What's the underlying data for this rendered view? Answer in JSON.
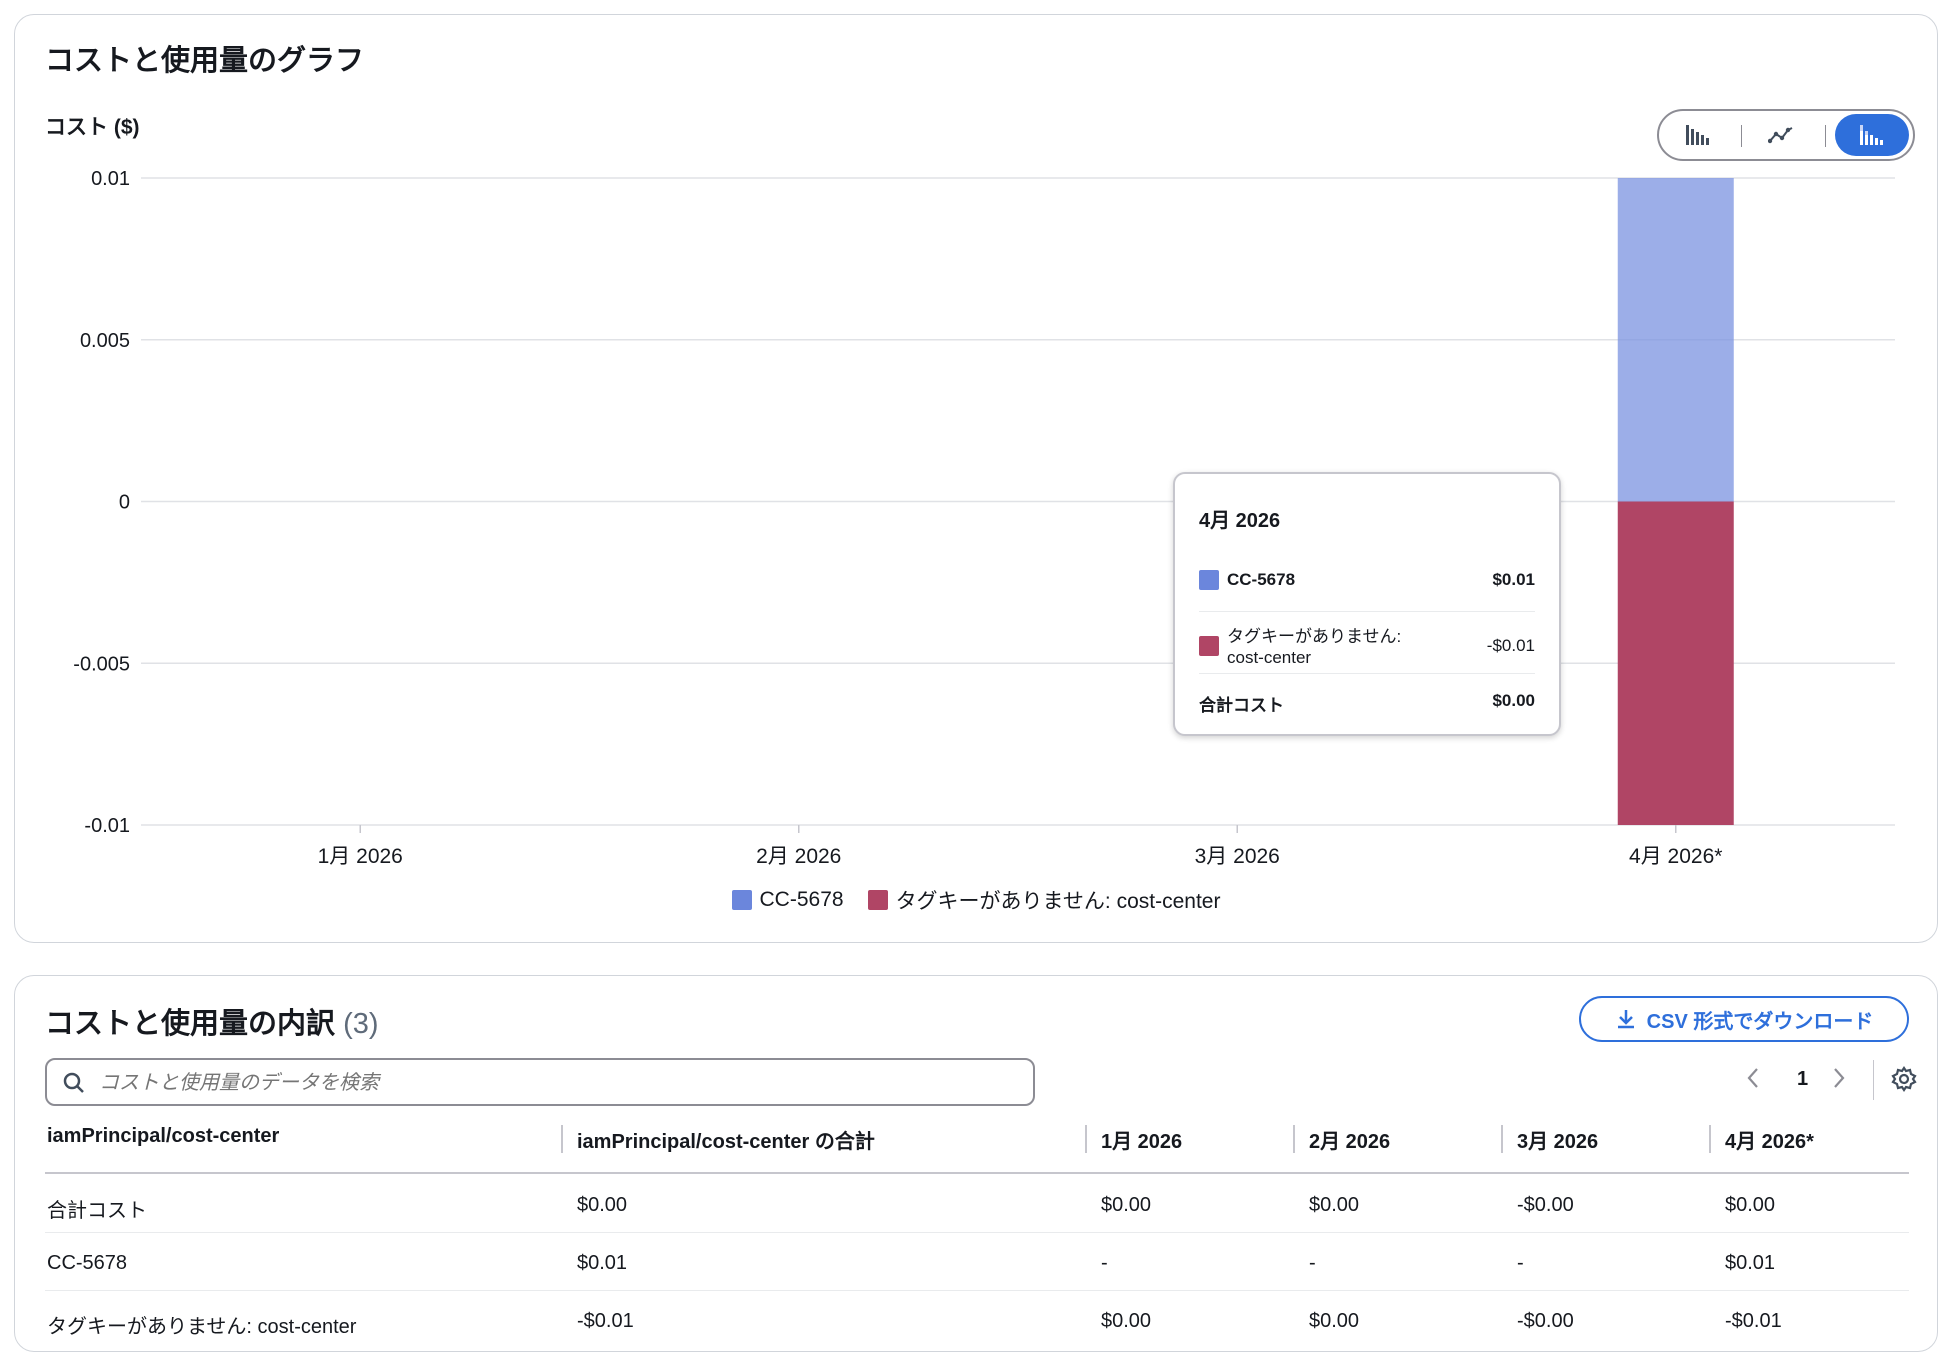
{
  "chart_section": {
    "title": "コストと使用量のグラフ",
    "y_axis_label": "コスト ($)",
    "toggle": [
      "bar-chart-icon",
      "line-chart-icon",
      "stacked-bar-chart-icon"
    ],
    "active_toggle": "stacked-bar-chart-icon"
  },
  "chart_data": {
    "type": "bar",
    "stacked": true,
    "categories": [
      "1月 2026",
      "2月 2026",
      "3月 2026",
      "4月 2026*"
    ],
    "series": [
      {
        "name": "CC-5678",
        "values": [
          0,
          0,
          0,
          0.01
        ],
        "color": "#7b93e0"
      },
      {
        "name": "タグキーがありません: cost-center",
        "values": [
          0,
          0,
          0,
          -0.01
        ],
        "color": "#b04565"
      }
    ],
    "y_ticks": [
      "0.01",
      "0.005",
      "0",
      "-0.005",
      "-0.01"
    ],
    "ylim": [
      -0.01,
      0.01
    ],
    "ylabel": "コスト ($)",
    "grid": true,
    "legend": "bottom-center"
  },
  "tooltip": {
    "title": "4月 2026",
    "rows": [
      {
        "label": "CC-5678",
        "value": "$0.01",
        "color": "#6b86dc"
      },
      {
        "label_line1": "タグキーがありません:",
        "label_line2": "cost-center",
        "value": "-$0.01",
        "color": "#b04565"
      }
    ],
    "total_label": "合計コスト",
    "total_value": "$0.00"
  },
  "legend": [
    {
      "label": "CC-5678",
      "color": "#6b86dc"
    },
    {
      "label": "タグキーがありません: cost-center",
      "color": "#b04565"
    }
  ],
  "breakdown": {
    "title": "コストと使用量の内訳",
    "count": "(3)",
    "download_label": "CSV 形式でダウンロード",
    "search_placeholder": "コストと使用量のデータを検索",
    "page": "1",
    "columns": [
      "iamPrincipal/cost-center",
      "iamPrincipal/cost-center の合計",
      "1月 2026",
      "2月 2026",
      "3月 2026",
      "4月 2026*"
    ],
    "rows": [
      [
        "合計コスト",
        "$0.00",
        "$0.00",
        "$0.00",
        "-$0.00",
        "$0.00"
      ],
      [
        "CC-5678",
        "$0.01",
        "-",
        "-",
        "-",
        "$0.01"
      ],
      [
        "タグキーがありません: cost-center",
        "-$0.01",
        "$0.00",
        "$0.00",
        "-$0.00",
        "-$0.01"
      ]
    ]
  }
}
